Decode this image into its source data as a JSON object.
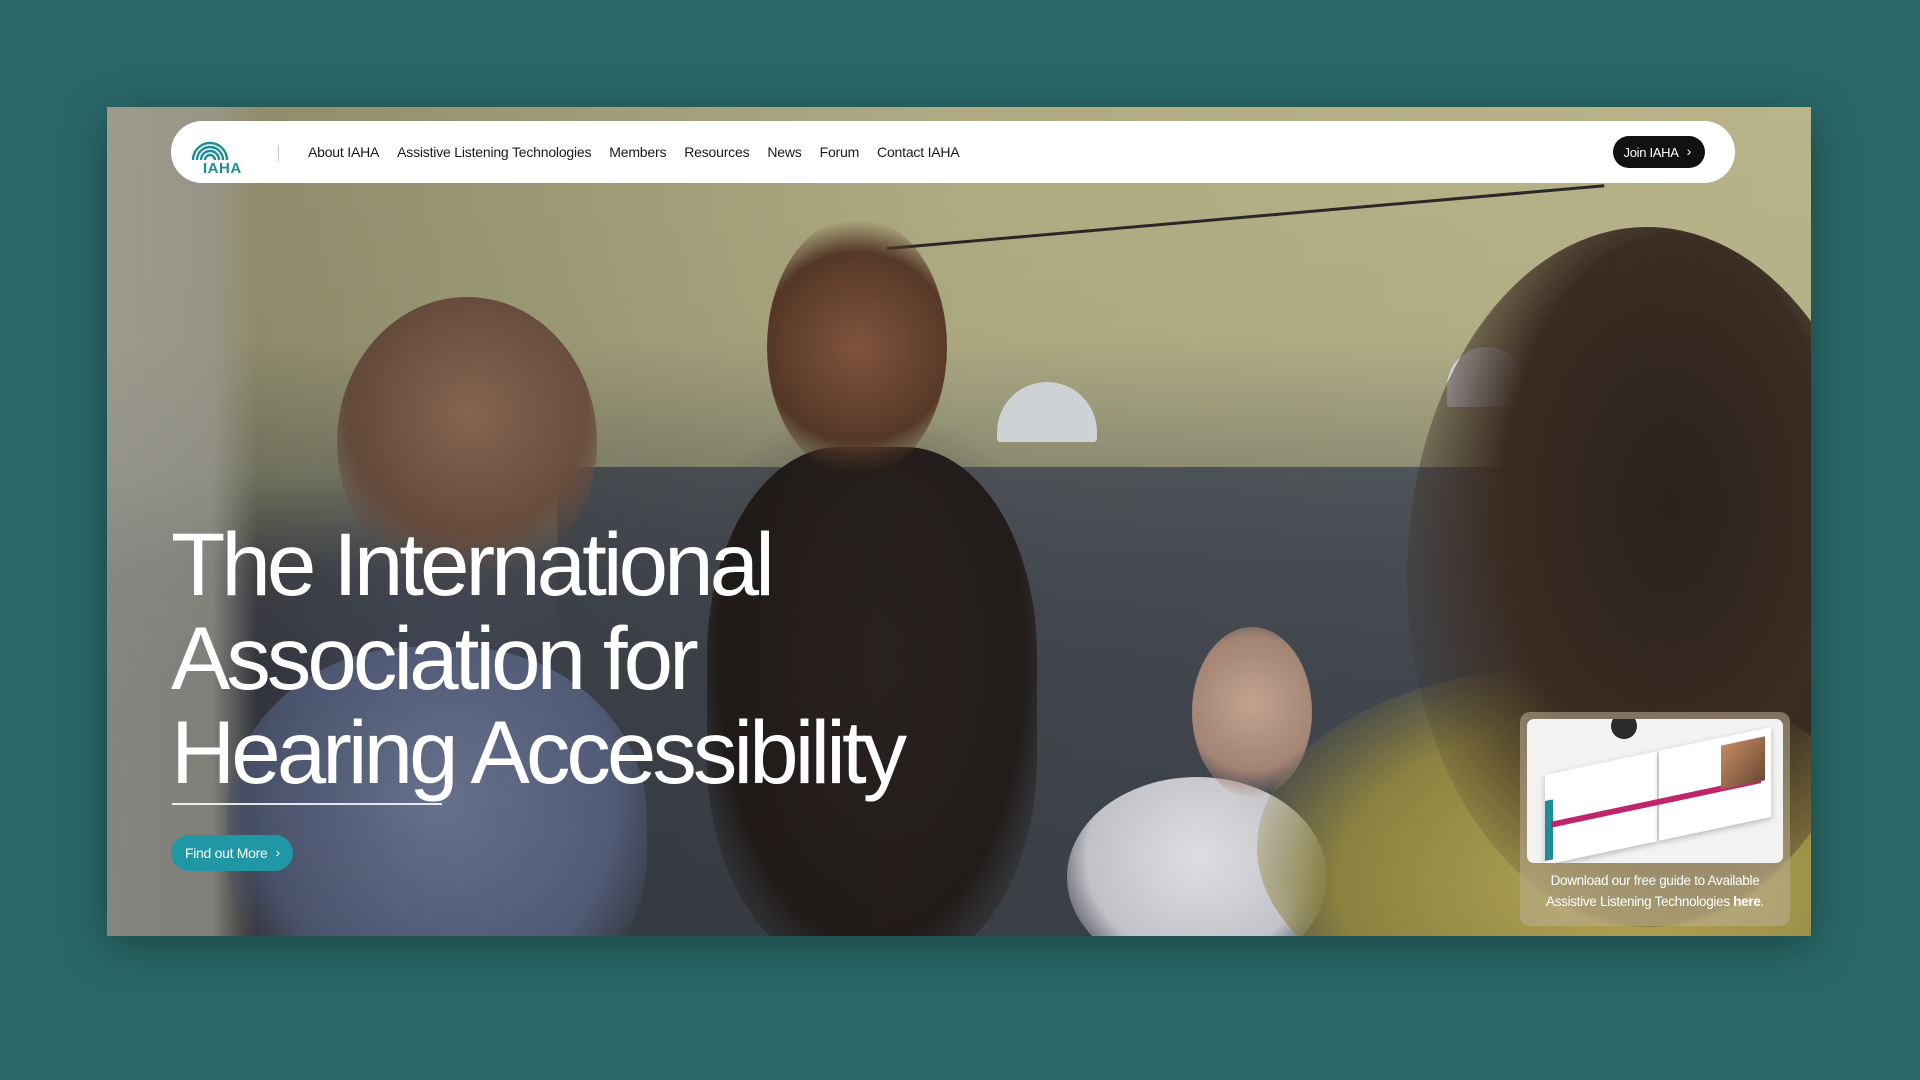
{
  "nav": {
    "logo_text": "IAHA",
    "items": [
      {
        "label": "About IAHA"
      },
      {
        "label": "Assistive Listening Technologies"
      },
      {
        "label": "Members"
      },
      {
        "label": "Resources"
      },
      {
        "label": "News"
      },
      {
        "label": "Forum"
      },
      {
        "label": "Contact IAHA"
      }
    ],
    "join_label": "Join IAHA"
  },
  "hero": {
    "title_lines": [
      "The International",
      "Association for",
      "Hearing Accessibility"
    ],
    "cta_label": "Find out More"
  },
  "guide": {
    "text_before": "Download our free guide to Available Assistive Listening Technologies ",
    "link_text": "here",
    "text_after": "."
  },
  "colors": {
    "background": "#2a6868",
    "accent_teal": "#1f97a5",
    "button_dark": "#111111"
  },
  "icons": {
    "chevron": "chevron-right-icon",
    "logo": "sound-waves-logo-icon"
  }
}
